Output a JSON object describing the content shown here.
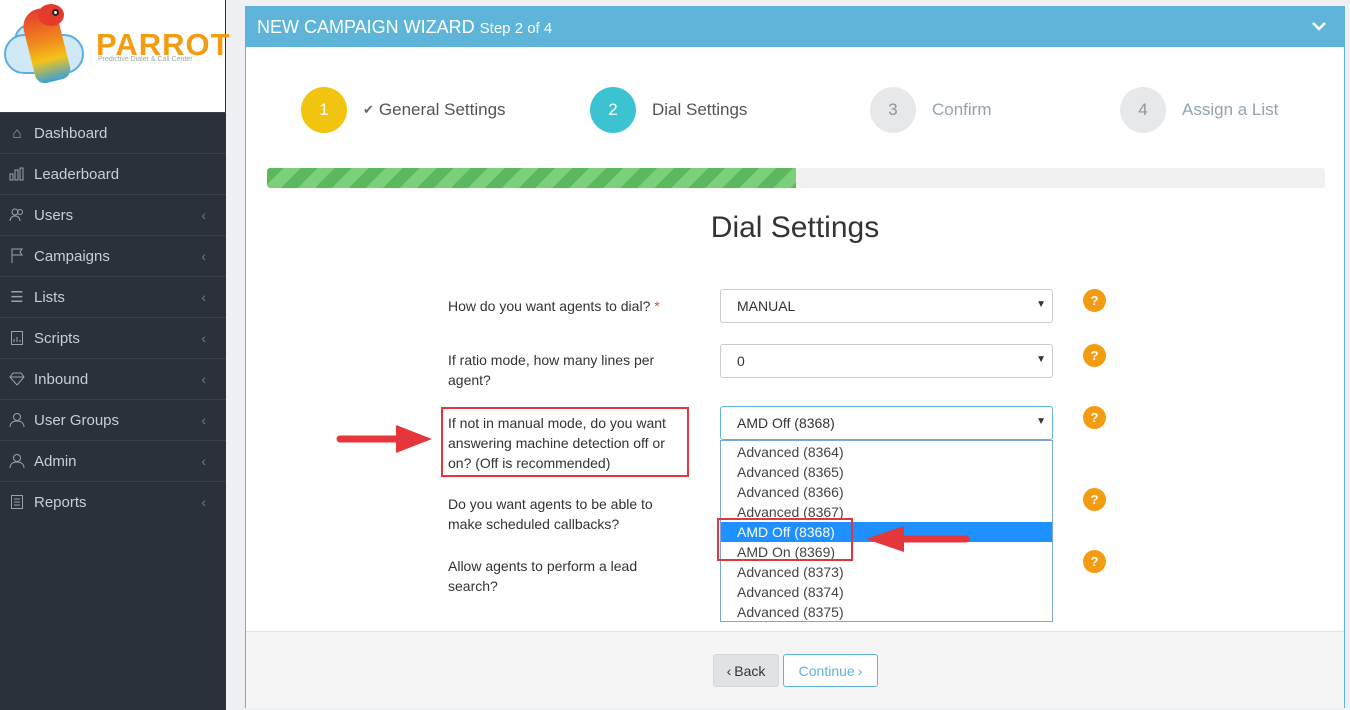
{
  "brand": {
    "name": "PARROT",
    "tagline": "Predictive Dialer & Call Center"
  },
  "sidebar": {
    "items": [
      {
        "label": "Dashboard",
        "icon": "home-icon",
        "chevron": false
      },
      {
        "label": "Leaderboard",
        "icon": "bar-chart-icon",
        "chevron": false
      },
      {
        "label": "Users",
        "icon": "users-icon",
        "chevron": true
      },
      {
        "label": "Campaigns",
        "icon": "flag-icon",
        "chevron": true
      },
      {
        "label": "Lists",
        "icon": "list-icon",
        "chevron": true
      },
      {
        "label": "Scripts",
        "icon": "script-icon",
        "chevron": true
      },
      {
        "label": "Inbound",
        "icon": "diamond-icon",
        "chevron": true
      },
      {
        "label": "User Groups",
        "icon": "user-icon",
        "chevron": true
      },
      {
        "label": "Admin",
        "icon": "user-icon",
        "chevron": true
      },
      {
        "label": "Reports",
        "icon": "document-icon",
        "chevron": true
      }
    ]
  },
  "header": {
    "title": "NEW CAMPAIGN WIZARD",
    "subtitle": "Step 2 of 4"
  },
  "steps": [
    {
      "num": "1",
      "label": "General Settings",
      "state": "done"
    },
    {
      "num": "2",
      "label": "Dial Settings",
      "state": "active"
    },
    {
      "num": "3",
      "label": "Confirm",
      "state": "pending"
    },
    {
      "num": "4",
      "label": "Assign a List",
      "state": "pending"
    }
  ],
  "progress": {
    "percent": 50
  },
  "section_title": "Dial Settings",
  "questions": {
    "dial_method": {
      "label": "How do you want agents to dial?",
      "required": "*",
      "value": "MANUAL"
    },
    "ratio": {
      "label": "If ratio mode, how many lines per agent?",
      "value": "0"
    },
    "amd": {
      "label": "If not in manual mode, do you want answering machine detection off or on? (Off is recommended)",
      "value": "AMD Off (8368)"
    },
    "callbacks": {
      "label": "Do you want agents to be able to make scheduled callbacks?"
    },
    "lead_search": {
      "label": "Allow agents to perform a lead search?"
    }
  },
  "amd_options": [
    "Advanced (8364)",
    "Advanced (8365)",
    "Advanced (8366)",
    "Advanced (8367)",
    "AMD Off (8368)",
    "AMD On (8369)",
    "Advanced (8373)",
    "Advanced (8374)",
    "Advanced (8375)"
  ],
  "amd_selected_index": 4,
  "help_glyph": "?",
  "buttons": {
    "back": "Back",
    "continue": "Continue"
  },
  "colors": {
    "header": "#5eb4d9",
    "step_done": "#f1c40f",
    "step_active": "#3cc3d2",
    "help": "#f39c12",
    "highlight": "#e5363c",
    "option_selected": "#1e90ff"
  }
}
